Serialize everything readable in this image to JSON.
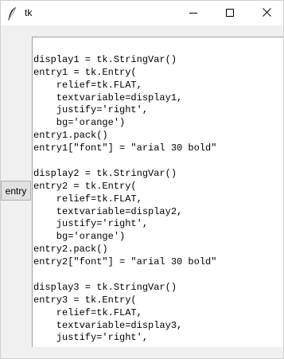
{
  "window": {
    "title": "tk"
  },
  "icons": {
    "app": "feather-icon",
    "minimize": "minimize-icon",
    "maximize": "maximize-icon",
    "close": "close-icon"
  },
  "button": {
    "label": "entry"
  },
  "code_lines": [
    "",
    "display1 = tk.StringVar()",
    "entry1 = tk.Entry(",
    "    relief=tk.FLAT,",
    "    textvariable=display1,",
    "    justify='right',",
    "    bg='orange')",
    "entry1.pack()",
    "entry1[\"font\"] = \"arial 30 bold\"",
    "",
    "display2 = tk.StringVar()",
    "entry2 = tk.Entry(",
    "    relief=tk.FLAT,",
    "    textvariable=display2,",
    "    justify='right',",
    "    bg='orange')",
    "entry2.pack()",
    "entry2[\"font\"] = \"arial 30 bold\"",
    "",
    "display3 = tk.StringVar()",
    "entry3 = tk.Entry(",
    "    relief=tk.FLAT,",
    "    textvariable=display3,",
    "    justify='right',"
  ]
}
